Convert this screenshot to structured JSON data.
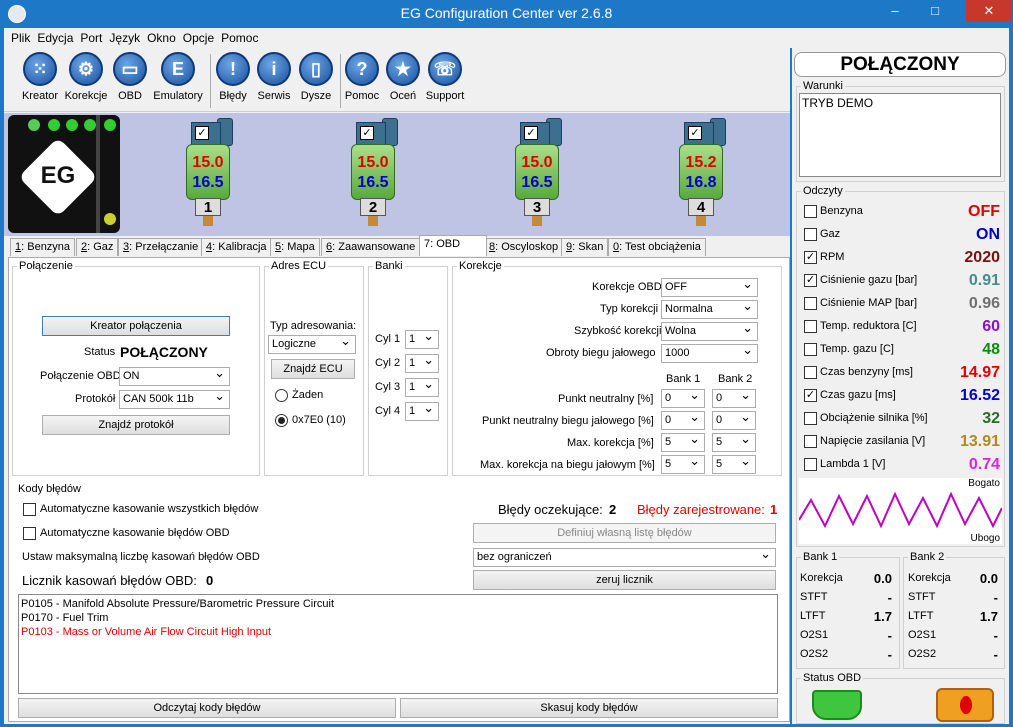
{
  "window": {
    "title": "EG Configuration Center ver 2.6.8",
    "minimize": "–",
    "maximize": "□",
    "close": "✕"
  },
  "menu": [
    "Plik",
    "Edycja",
    "Port",
    "Język",
    "Okno",
    "Opcje",
    "Pomoc"
  ],
  "toolbar": {
    "kreator": {
      "label": "Kreator",
      "glyph": "⁙"
    },
    "korekcje": {
      "label": "Korekcje",
      "glyph": "⚙"
    },
    "obd": {
      "label": "OBD",
      "glyph": "▭"
    },
    "emulatory": {
      "label": "Emulatory",
      "glyph": "E"
    },
    "bledy": {
      "label": "Błędy",
      "glyph": "!"
    },
    "serwis": {
      "label": "Serwis",
      "glyph": "i"
    },
    "dysze": {
      "label": "Dysze",
      "glyph": "▯"
    },
    "pomoc": {
      "label": "Pomoc",
      "glyph": "?"
    },
    "ocen": {
      "label": "Oceń",
      "glyph": "★"
    },
    "support": {
      "label": "Support",
      "glyph": "☏"
    }
  },
  "logo": {
    "text": "EG"
  },
  "injectors": [
    {
      "v1": "15.0",
      "v2": "16.5",
      "num": "1",
      "checked": "✓"
    },
    {
      "v1": "15.0",
      "v2": "16.5",
      "num": "2",
      "checked": "✓"
    },
    {
      "v1": "15.0",
      "v2": "16.5",
      "num": "3",
      "checked": "✓"
    },
    {
      "v1": "15.2",
      "v2": "16.8",
      "num": "4",
      "checked": "✓"
    }
  ],
  "tabs": {
    "t1": {
      "key": "1",
      "label": ": Benzyna"
    },
    "t2": {
      "key": "2",
      "label": ": Gaz"
    },
    "t3": {
      "key": "3",
      "label": ": Przełączanie"
    },
    "t4": {
      "key": "4",
      "label": ": Kalibracja"
    },
    "t5": {
      "key": "5",
      "label": ": Mapa"
    },
    "t6": {
      "key": "6",
      "label": ": Zaawansowane"
    },
    "t7": {
      "key": "7",
      "label": ": OBD"
    },
    "t8": {
      "key": "8",
      "label": ": Oscyloskop"
    },
    "t9": {
      "key": "9",
      "label": ": Skan"
    },
    "t0": {
      "key": "0",
      "label": ": Test obciążenia"
    }
  },
  "polaczenie": {
    "legend": "Połączenie",
    "kreator_btn": "Kreator połączenia",
    "status_label": "Status",
    "status_value": "POŁĄCZONY",
    "obd_label": "Połączenie OBD",
    "obd_value": "ON",
    "protokol_label": "Protokół",
    "protokol_value": "CAN 500k 11b",
    "znajdz_btn": "Znajdź protokół"
  },
  "adres": {
    "legend": "Adres ECU",
    "typ_label": "Typ adresowania:",
    "typ_value": "Logiczne",
    "znajdz_btn": "Znajdź ECU",
    "r1": "Żaden",
    "r2": "0x7E0 (10)"
  },
  "banki": {
    "legend": "Banki",
    "cyl": [
      {
        "label": "Cyl 1",
        "value": "1"
      },
      {
        "label": "Cyl 2",
        "value": "1"
      },
      {
        "label": "Cyl 3",
        "value": "1"
      },
      {
        "label": "Cyl 4",
        "value": "1"
      }
    ]
  },
  "korekcje": {
    "legend": "Korekcje",
    "obd_label": "Korekcje OBD",
    "obd_value": "OFF",
    "typ_label": "Typ korekcji",
    "typ_value": "Normalna",
    "szyb_label": "Szybkość korekcji",
    "szyb_value": "Wolna",
    "obroty_label": "Obroty biegu jałowego",
    "obroty_value": "1000",
    "bank1": "Bank 1",
    "bank2": "Bank 2",
    "rows": [
      {
        "label": "Punkt neutralny [%]",
        "b1": "0",
        "b2": "0"
      },
      {
        "label": "Punkt neutralny biegu jałowego [%]",
        "b1": "0",
        "b2": "0"
      },
      {
        "label": "Max. korekcja [%]",
        "b1": "5",
        "b2": "5"
      },
      {
        "label": "Max. korekcja na biegu jałowym [%]",
        "b1": "5",
        "b2": "5"
      }
    ]
  },
  "kody": {
    "legend": "Kody błędów",
    "auto_all": "Automatyczne kasowanie wszystkich błędów",
    "auto_obd": "Automatyczne kasowanie błędów OBD",
    "oczekujace_label": "Błędy oczekujące:",
    "oczekujace_value": "2",
    "zarejestrowane_label": "Błędy zarejestrowane:",
    "zarejestrowane_value": "1",
    "definiuj_btn": "Definiuj własną listę błędów",
    "max_label": "Ustaw maksymalną liczbę kasowań błędów OBD",
    "max_value": "bez ograniczeń",
    "licznik_label": "Licznik kasowań błędów OBD:",
    "licznik_value": "0",
    "zeruj_btn": "zeruj licznik",
    "list": [
      {
        "text": "P0105 - Manifold Absolute Pressure/Barometric Pressure Circuit",
        "color": "#000000"
      },
      {
        "text": "P0170 - Fuel Trim",
        "color": "#000000"
      },
      {
        "text": "P0103 - Mass or Volume Air Flow Circuit High Input",
        "color": "#e00000"
      }
    ],
    "odczytaj_btn": "Odczytaj kody błędów",
    "skasuj_btn": "Skasuj kody błędów"
  },
  "right": {
    "status": "POŁĄCZONY",
    "warunki_legend": "Warunki",
    "warunki_text": "TRYB DEMO",
    "odczyty_legend": "Odczyty",
    "readings": [
      {
        "label": "Benzyna",
        "value": "OFF",
        "color": "#e00000",
        "checked": ""
      },
      {
        "label": "Gaz",
        "value": "ON",
        "color": "#0000cc",
        "checked": ""
      },
      {
        "label": "RPM",
        "value": "2020",
        "color": "#7a1010",
        "checked": "✓"
      },
      {
        "label": "Ciśnienie gazu [bar]",
        "value": "0.91",
        "color": "#4a8a8a",
        "checked": "✓"
      },
      {
        "label": "Ciśnienie MAP [bar]",
        "value": "0.96",
        "color": "#707070",
        "checked": ""
      },
      {
        "label": "Temp. reduktora [C]",
        "value": "60",
        "color": "#8a10d0",
        "checked": ""
      },
      {
        "label": "Temp. gazu [C]",
        "value": "48",
        "color": "#108a10",
        "checked": ""
      },
      {
        "label": "Czas benzyny [ms]",
        "value": "14.97",
        "color": "#e00000",
        "checked": ""
      },
      {
        "label": "Czas gazu [ms]",
        "value": "16.52",
        "color": "#0000cc",
        "checked": "✓"
      },
      {
        "label": "Obciążenie silnika [%]",
        "value": "32",
        "color": "#2a6a2a",
        "checked": ""
      },
      {
        "label": "Napięcie zasilania [V]",
        "value": "13.91",
        "color": "#b08a20",
        "checked": ""
      },
      {
        "label": "Lambda 1 [V]",
        "value": "0.74",
        "color": "#e020e0",
        "checked": ""
      }
    ],
    "graph_top": "Bogato",
    "graph_bottom": "Ubogo",
    "bank1": {
      "legend": "Bank 1",
      "rows": [
        {
          "label": "Korekcja",
          "value": "0.0"
        },
        {
          "label": "STFT",
          "value": "-"
        },
        {
          "label": "LTFT",
          "value": "1.7"
        },
        {
          "label": "O2S1",
          "value": "-"
        },
        {
          "label": "O2S2",
          "value": "-"
        }
      ]
    },
    "bank2": {
      "legend": "Bank 2",
      "rows": [
        {
          "label": "Korekcja",
          "value": "0.0"
        },
        {
          "label": "STFT",
          "value": "-"
        },
        {
          "label": "LTFT",
          "value": "1.7"
        },
        {
          "label": "O2S1",
          "value": "-"
        },
        {
          "label": "O2S2",
          "value": "-"
        }
      ]
    },
    "status_obd_legend": "Status OBD"
  }
}
